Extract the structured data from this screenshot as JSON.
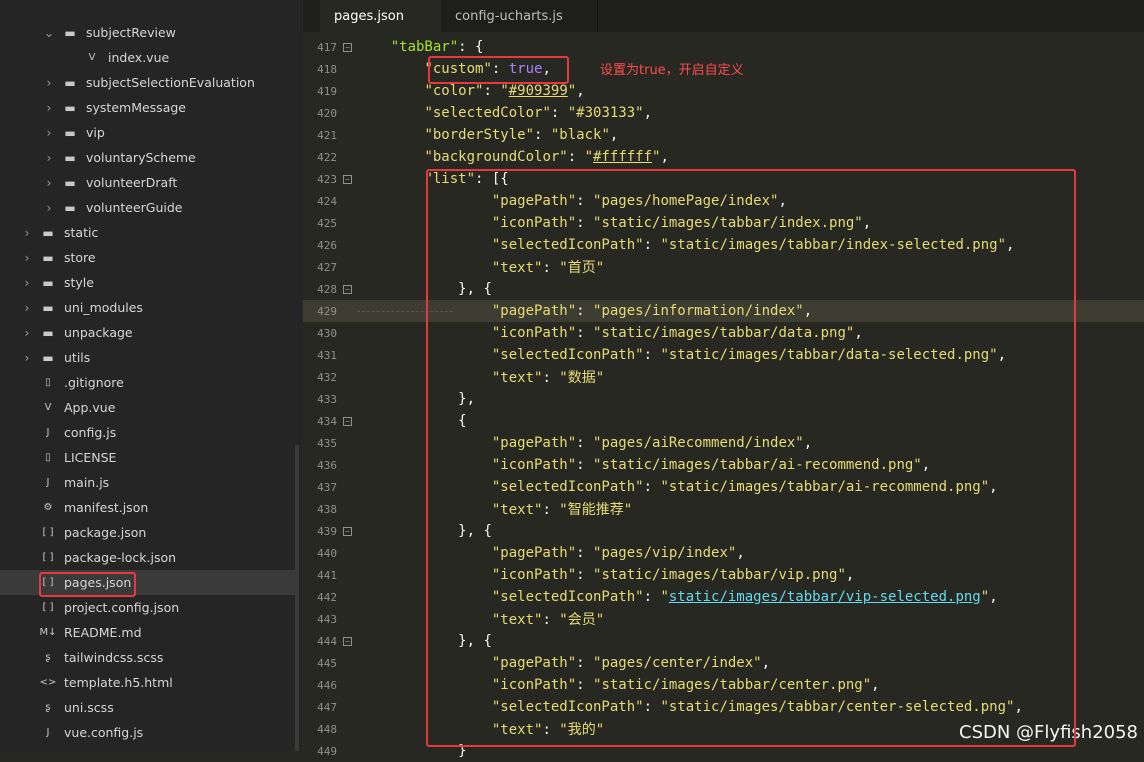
{
  "sidebar": {
    "items": [
      {
        "label": "subjectReview",
        "type": "folder-open",
        "depth": 2,
        "chev": "⌄"
      },
      {
        "label": "index.vue",
        "type": "vue",
        "depth": 3,
        "chev": ""
      },
      {
        "label": "subjectSelectionEvaluation",
        "type": "folder",
        "depth": 2,
        "chev": "›"
      },
      {
        "label": "systemMessage",
        "type": "folder",
        "depth": 2,
        "chev": "›"
      },
      {
        "label": "vip",
        "type": "folder",
        "depth": 2,
        "chev": "›"
      },
      {
        "label": "voluntaryScheme",
        "type": "folder",
        "depth": 2,
        "chev": "›"
      },
      {
        "label": "volunteerDraft",
        "type": "folder",
        "depth": 2,
        "chev": "›"
      },
      {
        "label": "volunteerGuide",
        "type": "folder",
        "depth": 2,
        "chev": "›"
      },
      {
        "label": "static",
        "type": "folder",
        "depth": 1,
        "chev": "›"
      },
      {
        "label": "store",
        "type": "folder",
        "depth": 1,
        "chev": "›"
      },
      {
        "label": "style",
        "type": "folder",
        "depth": 1,
        "chev": "›"
      },
      {
        "label": "uni_modules",
        "type": "folder",
        "depth": 1,
        "chev": "›"
      },
      {
        "label": "unpackage",
        "type": "folder",
        "depth": 1,
        "chev": "›"
      },
      {
        "label": "utils",
        "type": "folder",
        "depth": 1,
        "chev": "›"
      },
      {
        "label": ".gitignore",
        "type": "file",
        "depth": 1,
        "chev": ""
      },
      {
        "label": "App.vue",
        "type": "vue",
        "depth": 1,
        "chev": ""
      },
      {
        "label": "config.js",
        "type": "js",
        "depth": 1,
        "chev": ""
      },
      {
        "label": "LICENSE",
        "type": "file",
        "depth": 1,
        "chev": ""
      },
      {
        "label": "main.js",
        "type": "js",
        "depth": 1,
        "chev": ""
      },
      {
        "label": "manifest.json",
        "type": "gear",
        "depth": 1,
        "chev": ""
      },
      {
        "label": "package.json",
        "type": "json",
        "depth": 1,
        "chev": ""
      },
      {
        "label": "package-lock.json",
        "type": "json",
        "depth": 1,
        "chev": ""
      },
      {
        "label": "pages.json",
        "type": "json",
        "depth": 1,
        "chev": "",
        "selected": true
      },
      {
        "label": "project.config.json",
        "type": "json",
        "depth": 1,
        "chev": ""
      },
      {
        "label": "README.md",
        "type": "md",
        "depth": 1,
        "chev": ""
      },
      {
        "label": "tailwindcss.scss",
        "type": "scss",
        "depth": 1,
        "chev": ""
      },
      {
        "label": "template.h5.html",
        "type": "html",
        "depth": 1,
        "chev": ""
      },
      {
        "label": "uni.scss",
        "type": "scss",
        "depth": 1,
        "chev": ""
      },
      {
        "label": "vue.config.js",
        "type": "js",
        "depth": 1,
        "chev": ""
      }
    ]
  },
  "tabs": [
    {
      "label": "pages.json",
      "active": true
    },
    {
      "label": "config-ucharts.js",
      "active": false
    }
  ],
  "code": {
    "lines": [
      {
        "n": "417",
        "fold": true,
        "html": "    <span class='k'>\"tabBar\"</span><span class='pun'>: {</span>"
      },
      {
        "n": "418",
        "fold": false,
        "html": "        <span class='key'>\"custom\"</span><span class='pun'>: </span><span class='bool'>true</span><span class='pun'>,</span>"
      },
      {
        "n": "419",
        "fold": false,
        "html": "        <span class='key'>\"color\"</span><span class='pun'>: </span><span class='str'>\"<span class='under'>#909399</span>\"</span><span class='pun'>,</span>"
      },
      {
        "n": "420",
        "fold": false,
        "html": "        <span class='key'>\"selectedColor\"</span><span class='pun'>: </span><span class='str'>\"#303133\"</span><span class='pun'>,</span>"
      },
      {
        "n": "421",
        "fold": false,
        "html": "        <span class='key'>\"borderStyle\"</span><span class='pun'>: </span><span class='str'>\"black\"</span><span class='pun'>,</span>"
      },
      {
        "n": "422",
        "fold": false,
        "html": "        <span class='key'>\"backgroundColor\"</span><span class='pun'>: </span><span class='str'>\"<span class='under'>#ffffff</span>\"</span><span class='pun'>,</span>"
      },
      {
        "n": "423",
        "fold": true,
        "html": "        <span class='key'>\"list\"</span><span class='pun'>: [{</span>"
      },
      {
        "n": "424",
        "fold": false,
        "html": "                <span class='key'>\"pagePath\"</span><span class='pun'>: </span><span class='str'>\"pages/homePage/index\"</span><span class='pun'>,</span>"
      },
      {
        "n": "425",
        "fold": false,
        "html": "                <span class='key'>\"iconPath\"</span><span class='pun'>: </span><span class='str'>\"static/images/tabbar/index.png\"</span><span class='pun'>,</span>"
      },
      {
        "n": "426",
        "fold": false,
        "html": "                <span class='key'>\"selectedIconPath\"</span><span class='pun'>: </span><span class='str'>\"static/images/tabbar/index-selected.png\"</span><span class='pun'>,</span>"
      },
      {
        "n": "427",
        "fold": false,
        "html": "                <span class='key'>\"text\"</span><span class='pun'>: </span><span class='str'>\"首页\"</span>"
      },
      {
        "n": "428",
        "fold": true,
        "html": "            <span class='pun'>}, {</span>"
      },
      {
        "n": "429",
        "fold": false,
        "cur": true,
        "html": "                <span class='key'>\"pagePath\"</span><span class='pun'>: </span><span class='str'>\"pages/information/index\"</span><span class='pun'>,</span>"
      },
      {
        "n": "430",
        "fold": false,
        "html": "                <span class='key'>\"iconPath\"</span><span class='pun'>: </span><span class='str'>\"static/images/tabbar/data.png\"</span><span class='pun'>,</span>"
      },
      {
        "n": "431",
        "fold": false,
        "html": "                <span class='key'>\"selectedIconPath\"</span><span class='pun'>: </span><span class='str'>\"static/images/tabbar/data-selected.png\"</span><span class='pun'>,</span>"
      },
      {
        "n": "432",
        "fold": false,
        "html": "                <span class='key'>\"text\"</span><span class='pun'>: </span><span class='str'>\"数据\"</span>"
      },
      {
        "n": "433",
        "fold": false,
        "html": "            <span class='pun'>},</span>"
      },
      {
        "n": "434",
        "fold": true,
        "html": "            <span class='pun'>{</span>"
      },
      {
        "n": "435",
        "fold": false,
        "html": "                <span class='key'>\"pagePath\"</span><span class='pun'>: </span><span class='str'>\"pages/aiRecommend/index\"</span><span class='pun'>,</span>"
      },
      {
        "n": "436",
        "fold": false,
        "html": "                <span class='key'>\"iconPath\"</span><span class='pun'>: </span><span class='str'>\"static/images/tabbar/ai-recommend.png\"</span><span class='pun'>,</span>"
      },
      {
        "n": "437",
        "fold": false,
        "html": "                <span class='key'>\"selectedIconPath\"</span><span class='pun'>: </span><span class='str'>\"static/images/tabbar/ai-recommend.png\"</span><span class='pun'>,</span>"
      },
      {
        "n": "438",
        "fold": false,
        "html": "                <span class='key'>\"text\"</span><span class='pun'>: </span><span class='str'>\"智能推荐\"</span>"
      },
      {
        "n": "439",
        "fold": true,
        "html": "            <span class='pun'>}, {</span>"
      },
      {
        "n": "440",
        "fold": false,
        "html": "                <span class='key'>\"pagePath\"</span><span class='pun'>: </span><span class='str'>\"pages/vip/index\"</span><span class='pun'>,</span>"
      },
      {
        "n": "441",
        "fold": false,
        "html": "                <span class='key'>\"iconPath\"</span><span class='pun'>: </span><span class='str'>\"static/images/tabbar/vip.png\"</span><span class='pun'>,</span>"
      },
      {
        "n": "442",
        "fold": false,
        "html": "                <span class='key'>\"selectedIconPath\"</span><span class='pun'>: </span><span class='str'>\"<span class='link'>static/images/tabbar/vip-selected.png</span>\"</span><span class='pun'>,</span>"
      },
      {
        "n": "443",
        "fold": false,
        "html": "                <span class='key'>\"text\"</span><span class='pun'>: </span><span class='str'>\"会员\"</span>"
      },
      {
        "n": "444",
        "fold": true,
        "html": "            <span class='pun'>}, {</span>"
      },
      {
        "n": "445",
        "fold": false,
        "html": "                <span class='key'>\"pagePath\"</span><span class='pun'>: </span><span class='str'>\"pages/center/index\"</span><span class='pun'>,</span>"
      },
      {
        "n": "446",
        "fold": false,
        "html": "                <span class='key'>\"iconPath\"</span><span class='pun'>: </span><span class='str'>\"static/images/tabbar/center.png\"</span><span class='pun'>,</span>"
      },
      {
        "n": "447",
        "fold": false,
        "html": "                <span class='key'>\"selectedIconPath\"</span><span class='pun'>: </span><span class='str'>\"static/images/tabbar/center-selected.png\"</span><span class='pun'>,</span>"
      },
      {
        "n": "448",
        "fold": false,
        "html": "                <span class='key'>\"text\"</span><span class='pun'>: </span><span class='str'>\"我的\"</span>"
      },
      {
        "n": "449",
        "fold": false,
        "html": "            <span class='pun'>}</span>"
      }
    ]
  },
  "annotation": "设置为true，开启自定义",
  "watermark": "CSDN @Flyfish2058",
  "colors": {
    "highlight_box": "#e5393f",
    "annotation": "#ff4d4f"
  }
}
